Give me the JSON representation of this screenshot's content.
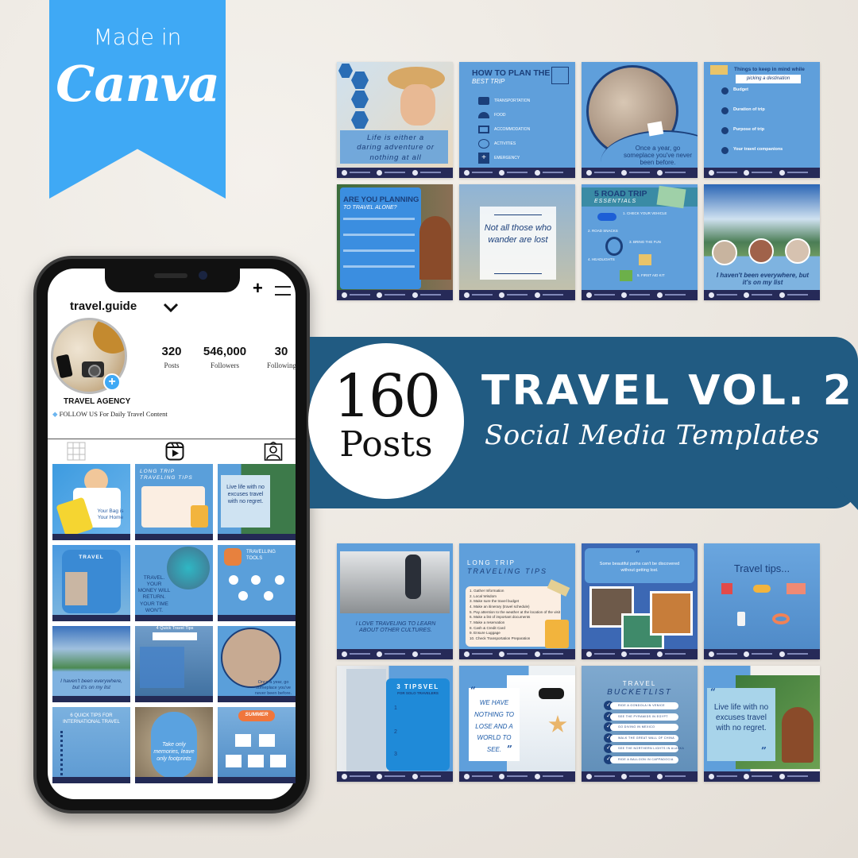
{
  "ribbon": {
    "line1": "Made in",
    "line2": "Canva",
    "color": "#3fa9f5"
  },
  "banner": {
    "count": "160",
    "count_label": "Posts",
    "title": "TRAVEL VOL. 2",
    "subtitle": "Social Media Templates",
    "color": "#215b82"
  },
  "profile": {
    "username": "travel.guide",
    "stats": [
      {
        "value": "320",
        "label": "Posts"
      },
      {
        "value": "546,000",
        "label": "Followers"
      },
      {
        "value": "30",
        "label": "Following"
      }
    ],
    "name": "TRAVEL AGENCY",
    "bio": "FOLLOW US For Daily Travel Content",
    "icons": [
      "plus-icon",
      "menu-icon",
      "chevron-down-icon",
      "grid-icon",
      "reels-icon",
      "tagged-icon",
      "add-story-icon"
    ]
  },
  "phone_grid": [
    {
      "caption": "Your Bag is Your Home"
    },
    {
      "caption": "LONG TRIP TRAVELING TIPS"
    },
    {
      "caption": "Live life with no excuses travel with no regret."
    },
    {
      "caption": "TRAVEL"
    },
    {
      "caption": "TRAVEL. YOUR MONEY WILL RETURN. YOUR TIME WON'T."
    },
    {
      "caption": "TRAVELLING TOOLS"
    },
    {
      "caption": "I haven't been everywhere, but it's on my list"
    },
    {
      "caption": "4 Quick Travel Tips"
    },
    {
      "caption": "Once a year, go someplace you've never been before."
    },
    {
      "caption": "6 QUICK TIPS FOR INTERNATIONAL TRAVEL"
    },
    {
      "caption": "Take only memories, leave only footprints"
    },
    {
      "caption": "SUMMER"
    }
  ],
  "templates_top": [
    {
      "quote": "Life is either a daring adventure or nothing at all"
    },
    {
      "title": "HOW TO PLAN THE",
      "subtitle": "BEST TRIP",
      "items": [
        "TRANSPORTATION",
        "FOOD",
        "ACCOMMODATION",
        "ACTIVITIES",
        "EMERGENCY"
      ]
    },
    {
      "quote": "Once a year, go someplace you've never been before."
    },
    {
      "title": "Things to keep in mind while",
      "subtitle": "picking a destination",
      "items": [
        "Budget",
        "Duration of trip",
        "Purpose of trip",
        "Your travel companions"
      ]
    },
    {
      "title": "ARE YOU PLANNING",
      "subtitle": "TO TRAVEL ALONE?"
    },
    {
      "quote": "Not all those who wander are lost"
    },
    {
      "title": "5 ROAD TRIP",
      "subtitle": "ESSENTIALS",
      "items": [
        "1. CHECK YOUR VEHICLE",
        "2. ROAD SNACKS",
        "3. BRING THE FUN",
        "4. HEADLIGHTS",
        "5. FIRST AID KIT"
      ]
    },
    {
      "quote": "I haven't been everywhere, but it's on my list"
    }
  ],
  "templates_bottom": [
    {
      "quote": "I LOVE TRAVELING TO LEARN ABOUT OTHER CULTURES."
    },
    {
      "title": "LONG TRIP",
      "subtitle": "TRAVELING TIPS",
      "items": [
        "1. Gather Information",
        "2. Local Wisdom",
        "3. Make sure the travel budget",
        "4. Make an itinerary (travel schedule)",
        "5. Pay attention to the weather at the location of the visit",
        "6. Make a list of important documents",
        "7. Make a reservation",
        "8. Cash & Credit Card",
        "9. Ensure Luggage",
        "10. Check Transportation Preparation"
      ]
    },
    {
      "quote": "Some beautiful paths can't be discovered without getting lost."
    },
    {
      "title": "Travel tips..."
    },
    {
      "title": "3 TIPSVEL",
      "subtitle": "FOR SOLO TRAVELERS",
      "items": [
        "1",
        "2",
        "3"
      ]
    },
    {
      "quote": "WE HAVE NOTHING TO LOSE AND A WORLD TO SEE."
    },
    {
      "title": "TRAVEL",
      "subtitle": "BUCKETLIST",
      "items": [
        "RIDE A GONDOLA IN VENICE",
        "SEE THE PYRAMIDS IN EGYPT",
        "GO DIVING IN MEXICO",
        "WALK THE GREAT WALL OF CHINA",
        "SEE THE NORTHERN LIGHTS IN ALASKA",
        "RIDE A BALLOON IN CAPPADOCIA"
      ]
    },
    {
      "quote": "Live life with no excuses travel with no regret."
    }
  ]
}
